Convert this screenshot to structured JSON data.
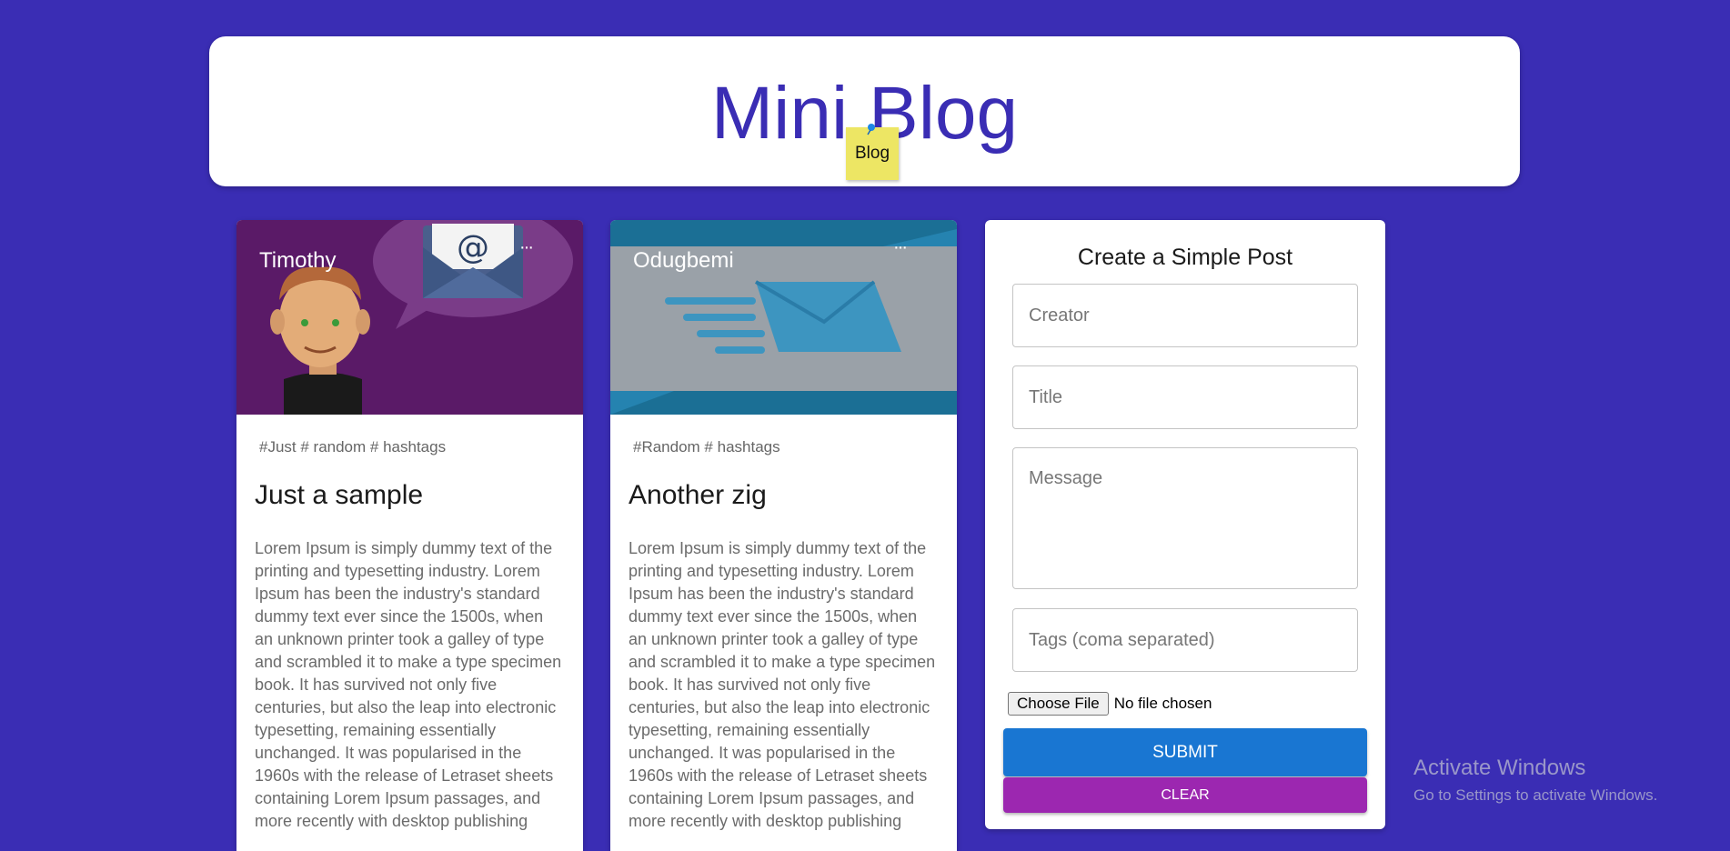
{
  "header": {
    "title": "Mini Blog",
    "nav_label": "Blog"
  },
  "posts": [
    {
      "creator": "Timothy",
      "more_label": "···",
      "tags": "#Just # random # hashtags",
      "title": "Just a sample",
      "message": "Lorem Ipsum is simply dummy text of the printing and typesetting industry. Lorem Ipsum has been the industry's standard dummy text ever since the 1500s, when an unknown printer took a galley of type and scrambled it to make a type specimen book. It has survived not only five centuries, but also the leap into electronic typesetting, remaining essentially unchanged. It was popularised in the 1960s with the release of Letraset sheets containing Lorem Ipsum passages, and more recently with desktop publishing"
    },
    {
      "creator": "Odugbemi",
      "more_label": "···",
      "tags": "#Random # hashtags",
      "title": "Another zig",
      "message": "Lorem Ipsum is simply dummy text of the printing and typesetting industry. Lorem Ipsum has been the industry's standard dummy text ever since the 1500s, when an unknown printer took a galley of type and scrambled it to make a type specimen book. It has survived not only five centuries, but also the leap into electronic typesetting, remaining essentially unchanged. It was popularised in the 1960s with the release of Letraset sheets containing Lorem Ipsum passages, and more recently with desktop publishing"
    }
  ],
  "form": {
    "title": "Create a Simple Post",
    "creator_placeholder": "Creator",
    "title_placeholder": "Title",
    "message_placeholder": "Message",
    "tags_placeholder": "Tags (coma separated)",
    "file_button": "Choose File",
    "file_status": "No file chosen",
    "submit_label": "SUBMIT",
    "clear_label": "CLEAR"
  },
  "watermark": {
    "title": "Activate Windows",
    "subtitle": "Go to Settings to activate Windows."
  },
  "colors": {
    "background": "#3a2db4",
    "brand": "#3a2db4",
    "submit": "#1976d2",
    "clear": "#9c27b0",
    "sticky_note": "#ede664"
  },
  "icons": {
    "sticky_pin": "pushpin-icon",
    "more": "more-horiz-icon"
  }
}
